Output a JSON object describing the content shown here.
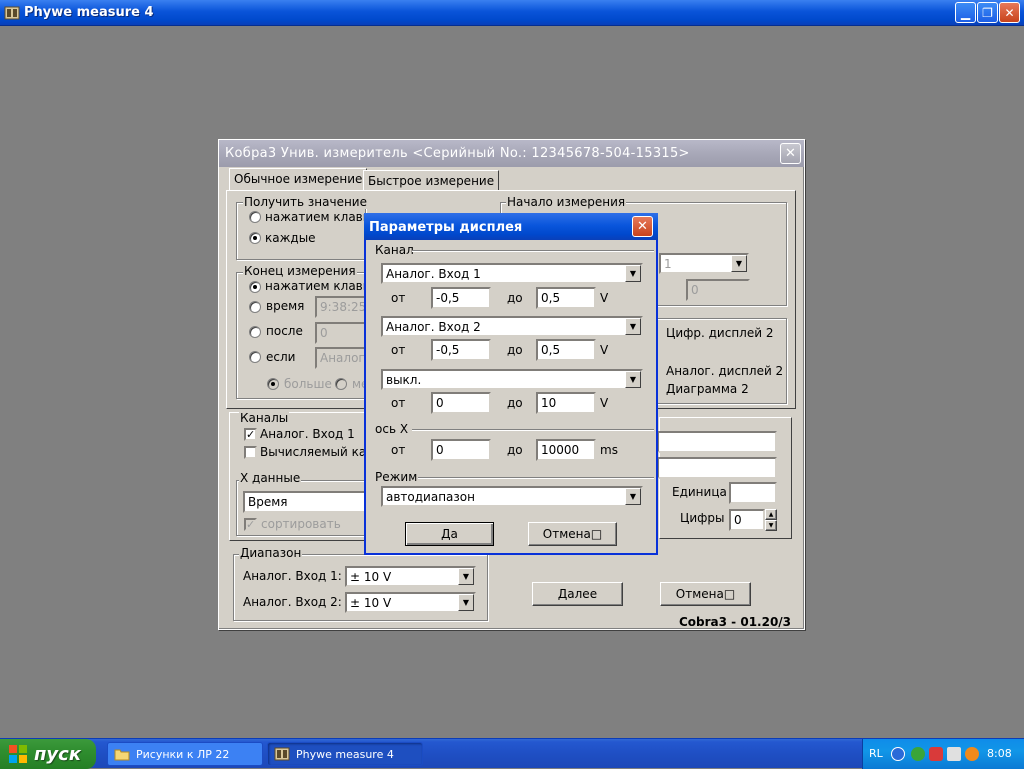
{
  "app": {
    "title": "Phywe measure 4",
    "min_glyph": "▁",
    "max_glyph": "❐",
    "close_glyph": "✕"
  },
  "cobra": {
    "title": "Кобра3 Унив. измеритель  <Серийный No.: 12345678-504-15315>",
    "close_glyph": "✕",
    "tabs": [
      "Обычное измерение",
      "Быстрое измерение"
    ],
    "get_value": {
      "title": "Получить значение",
      "on_key": "нажатием клавиш",
      "every": "каждые"
    },
    "start": {
      "title": "Начало измерения",
      "combo_value": "1",
      "field_value": "0"
    },
    "end": {
      "title": "Конец измерения",
      "on_key": "нажатием клавиш",
      "time": "время",
      "time_value": "9:38:25",
      "after": "после",
      "after_value": "0",
      "if": "если",
      "if_value": "Аналог.",
      "more": "больше",
      "less": "ме"
    },
    "displays": {
      "digital2": "Цифр. дисплей 2",
      "analog2": "Аналог. дисплей 2",
      "diagram2": "Диаграмма 2"
    },
    "channels": {
      "title": "Каналы",
      "analog1": "Аналог. Вход 1",
      "computed": "Вычисляемый кан"
    },
    "xdata": {
      "title": "X данные",
      "value": "Время",
      "sort": "сортировать"
    },
    "unit_label": "Единица",
    "digits_label": "Цифры",
    "digits_value": "0",
    "range": {
      "title": "Диапазон",
      "analog1_label": "Аналог. Вход 1:",
      "analog1_value": "± 10 V",
      "analog2_label": "Аналог. Вход 2:",
      "analog2_value": "± 10 V"
    },
    "next_button": "Далее",
    "cancel_button": "Отмена□",
    "version": "Cobra3 - 01.20/3"
  },
  "display_dialog": {
    "title": "Параметры дисплея",
    "close_glyph": "✕",
    "channel_label": "Канал",
    "from_label": "от",
    "to_label": "до",
    "channels": [
      {
        "source": "Аналог. Вход 1",
        "from": "-0,5",
        "to": "0,5",
        "unit": "V"
      },
      {
        "source": "Аналог. Вход 2",
        "from": "-0,5",
        "to": "0,5",
        "unit": "V"
      },
      {
        "source": "выкл.",
        "from": "0",
        "to": "10",
        "unit": "V"
      }
    ],
    "xaxis": {
      "label": "ось X",
      "from": "0",
      "to": "10000",
      "unit": "ms"
    },
    "mode": {
      "label": "Режим",
      "value": "автодиапазон"
    },
    "ok_button": "Да",
    "cancel_button": "Отмена□"
  },
  "taskbar": {
    "start_label": "пуск",
    "tasks": [
      {
        "label": "Рисунки к ЛР 22",
        "icon": "folder-icon"
      },
      {
        "label": "Phywe measure 4",
        "icon": "app-icon"
      }
    ],
    "language": "RL",
    "clock": "8:08"
  }
}
